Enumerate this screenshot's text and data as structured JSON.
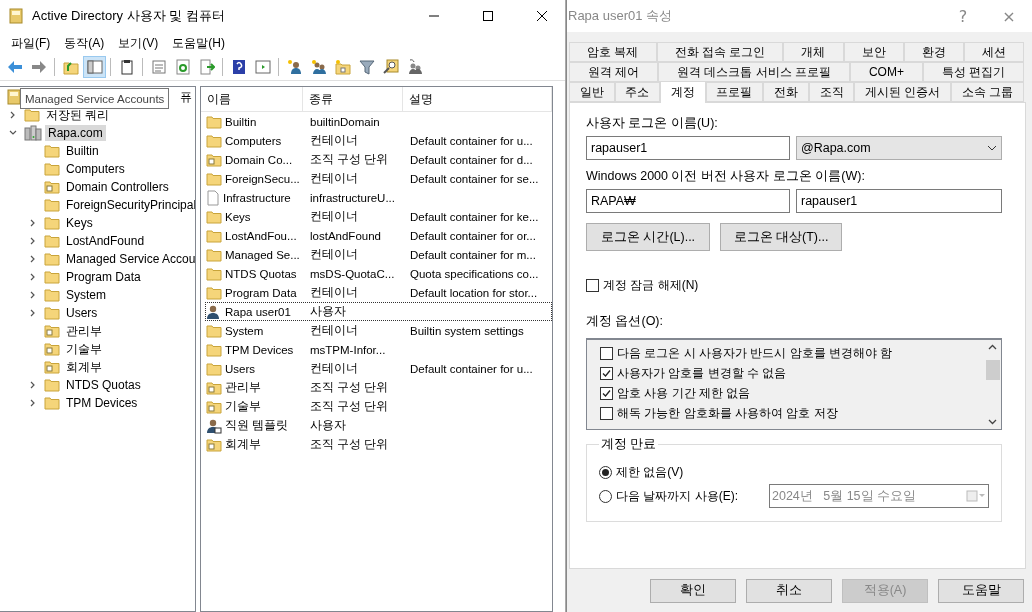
{
  "main_window": {
    "title": "Active Directory 사용자 및 컴퓨터",
    "menu": [
      "파일(F)",
      "동작(A)",
      "보기(V)",
      "도움말(H)"
    ],
    "toolbar": [
      {
        "kind": "back",
        "pressed": false
      },
      {
        "kind": "forward",
        "pressed": false
      },
      {
        "kind": "separator"
      },
      {
        "kind": "up",
        "pressed": false
      },
      {
        "kind": "tree",
        "pressed": true
      },
      {
        "kind": "separator"
      },
      {
        "kind": "clipboard",
        "pressed": false
      },
      {
        "kind": "separator"
      },
      {
        "kind": "properties",
        "pressed": false
      },
      {
        "kind": "refresh",
        "pressed": false
      },
      {
        "kind": "export",
        "pressed": false
      },
      {
        "kind": "separator"
      },
      {
        "kind": "help",
        "pressed": false
      },
      {
        "kind": "panel",
        "pressed": false
      },
      {
        "kind": "separator"
      },
      {
        "kind": "new-user",
        "pressed": false
      },
      {
        "kind": "new-group",
        "pressed": false
      },
      {
        "kind": "new-ou",
        "pressed": false
      },
      {
        "kind": "filter",
        "pressed": false
      },
      {
        "kind": "find",
        "pressed": false
      },
      {
        "kind": "add-group",
        "pressed": false
      }
    ],
    "tooltip": "Managed Service Accounts",
    "tree": {
      "root_visible_text": "퓨",
      "items": [
        {
          "label": "저장된 쿼리",
          "kind": "folder",
          "expandable": true,
          "expanded": false,
          "selected": false
        },
        {
          "label": "Rapa.com",
          "kind": "domain",
          "expandable": true,
          "expanded": true,
          "selected": true,
          "children": [
            {
              "label": "Builtin",
              "kind": "folder",
              "expandable": false,
              "selected": false
            },
            {
              "label": "Computers",
              "kind": "folder",
              "expandable": false,
              "selected": false
            },
            {
              "label": "Domain Controllers",
              "kind": "ou",
              "expandable": false,
              "selected": false
            },
            {
              "label": "ForeignSecurityPrincipal",
              "kind": "folder",
              "expandable": false,
              "selected": false
            },
            {
              "label": "Keys",
              "kind": "folder",
              "expandable": true,
              "expanded": false,
              "selected": false
            },
            {
              "label": "LostAndFound",
              "kind": "folder",
              "expandable": true,
              "expanded": false,
              "selected": false
            },
            {
              "label": "Managed Service Accou",
              "kind": "folder",
              "expandable": true,
              "expanded": false,
              "selected": false
            },
            {
              "label": "Program Data",
              "kind": "folder",
              "expandable": true,
              "expanded": false,
              "selected": false
            },
            {
              "label": "System",
              "kind": "folder",
              "expandable": true,
              "expanded": false,
              "selected": false
            },
            {
              "label": "Users",
              "kind": "folder",
              "expandable": true,
              "expanded": false,
              "selected": false
            },
            {
              "label": "관리부",
              "kind": "ou",
              "expandable": false,
              "selected": false
            },
            {
              "label": "기술부",
              "kind": "ou",
              "expandable": false,
              "selected": false
            },
            {
              "label": "회계부",
              "kind": "ou",
              "expandable": false,
              "selected": false
            },
            {
              "label": "NTDS Quotas",
              "kind": "folder",
              "expandable": true,
              "expanded": false,
              "selected": false
            },
            {
              "label": "TPM Devices",
              "kind": "folder",
              "expandable": true,
              "expanded": false,
              "selected": false
            }
          ]
        }
      ]
    },
    "list": {
      "columns": [
        "이름",
        "종류",
        "설명"
      ],
      "rows": [
        {
          "kind": "folder",
          "name": "Builtin",
          "type": "builtinDomain",
          "focused": false
        },
        {
          "kind": "folder",
          "name": "Computers",
          "type": "컨테이너",
          "description": "Default container for u...",
          "focused": false
        },
        {
          "kind": "ou",
          "name": "Domain Co...",
          "type": "조직 구성 단위",
          "description": "Default container for d...",
          "focused": false
        },
        {
          "kind": "folder",
          "name": "ForeignSecu...",
          "type": "컨테이너",
          "description": "Default container for se...",
          "focused": false
        },
        {
          "kind": "file",
          "name": "Infrastructure",
          "type": "infrastructureU...",
          "focused": false
        },
        {
          "kind": "folder",
          "name": "Keys",
          "type": "컨테이너",
          "description": "Default container for ke...",
          "focused": false
        },
        {
          "kind": "folder",
          "name": "LostAndFou...",
          "type": "lostAndFound",
          "description": "Default container for or...",
          "focused": false
        },
        {
          "kind": "folder",
          "name": "Managed Se...",
          "type": "컨테이너",
          "description": "Default container for m...",
          "focused": false
        },
        {
          "kind": "folder",
          "name": "NTDS Quotas",
          "type": "msDS-QuotaC...",
          "description": "Quota specifications co...",
          "focused": false
        },
        {
          "kind": "folder",
          "name": "Program Data",
          "type": "컨테이너",
          "description": "Default location for stor...",
          "focused": false
        },
        {
          "kind": "user",
          "name": "Rapa user01",
          "type": "사용자",
          "focused": true
        },
        {
          "kind": "folder",
          "name": "System",
          "type": "컨테이너",
          "description": "Builtin system settings",
          "focused": false
        },
        {
          "kind": "folder",
          "name": "TPM Devices",
          "type": "msTPM-Infor...",
          "focused": false
        },
        {
          "kind": "folder",
          "name": "Users",
          "type": "컨테이너",
          "description": "Default container for u...",
          "focused": false
        },
        {
          "kind": "ou",
          "name": "관리부",
          "type": "조직 구성 단위",
          "focused": false
        },
        {
          "kind": "ou",
          "name": "기술부",
          "type": "조직 구성 단위",
          "focused": false
        },
        {
          "kind": "user-template",
          "name": "직원 템플릿",
          "type": "사용자",
          "focused": false
        },
        {
          "kind": "ou",
          "name": "회계부",
          "type": "조직 구성 단위",
          "focused": false
        }
      ]
    }
  },
  "dialog": {
    "title": "Rapa user01 속성",
    "help": "?",
    "close": "×",
    "tab_rows": [
      {
        "tabs": [
          {
            "label": "암호 복제",
            "selected": false
          },
          {
            "label": "전화 접속 로그인",
            "selected": false
          },
          {
            "label": "개체",
            "selected": false
          },
          {
            "label": "보안",
            "selected": false
          },
          {
            "label": "환경",
            "selected": false
          },
          {
            "label": "세션",
            "selected": false
          }
        ]
      },
      {
        "tabs": [
          {
            "label": "원격 제어",
            "selected": false
          },
          {
            "label": "원격 데스크톱 서비스 프로필",
            "selected": false
          },
          {
            "label": "COM+",
            "selected": false
          },
          {
            "label": "특성 편집기",
            "selected": false
          }
        ]
      },
      {
        "tabs": [
          {
            "label": "일반",
            "selected": false
          },
          {
            "label": "주소",
            "selected": false
          },
          {
            "label": "계정",
            "selected": true
          },
          {
            "label": "프로필",
            "selected": false
          },
          {
            "label": "전화",
            "selected": false
          },
          {
            "label": "조직",
            "selected": false
          },
          {
            "label": "게시된 인증서",
            "selected": false
          },
          {
            "label": "소속 그룹",
            "selected": false
          }
        ]
      }
    ],
    "logon_name_label": "사용자 로그온 이름(U):",
    "logon_name": "rapauser1",
    "domain": "@Rapa.com",
    "legacy_label": "Windows 2000 이전 버전 사용자 로그온 이름(W):",
    "legacy_domain": "RAPA₩",
    "legacy_name": "rapauser1",
    "logon_buttons": [
      "로그온 시간(L)...",
      "로그온 대상(T)..."
    ],
    "unlock": {
      "label": "계정 잠금 해제(N)",
      "checked": false
    },
    "options_label": "계정 옵션(O):",
    "options": [
      {
        "label": "다음 로그온 시 사용자가 반드시 암호를 변경해야 함",
        "checked": false
      },
      {
        "label": "사용자가 암호를 변경할 수 없음",
        "checked": true
      },
      {
        "label": "암호 사용 기간 제한 없음",
        "checked": true
      },
      {
        "label": "해독 가능한 암호화를 사용하여 암호 저장",
        "checked": false
      }
    ],
    "expiry": {
      "title": "계정 만료",
      "choices": [
        {
          "label": "제한 없음(V)",
          "selected": true
        },
        {
          "label": "다음 날짜까지 사용(E):",
          "selected": false
        }
      ],
      "date": "2024년   5월 15일 수요일",
      "date_disabled": true
    },
    "footer_buttons": [
      {
        "label": "확인",
        "disabled": false
      },
      {
        "label": "취소",
        "disabled": false
      },
      {
        "label": "적용(A)",
        "disabled": true
      },
      {
        "label": "도움말",
        "disabled": false
      }
    ]
  }
}
